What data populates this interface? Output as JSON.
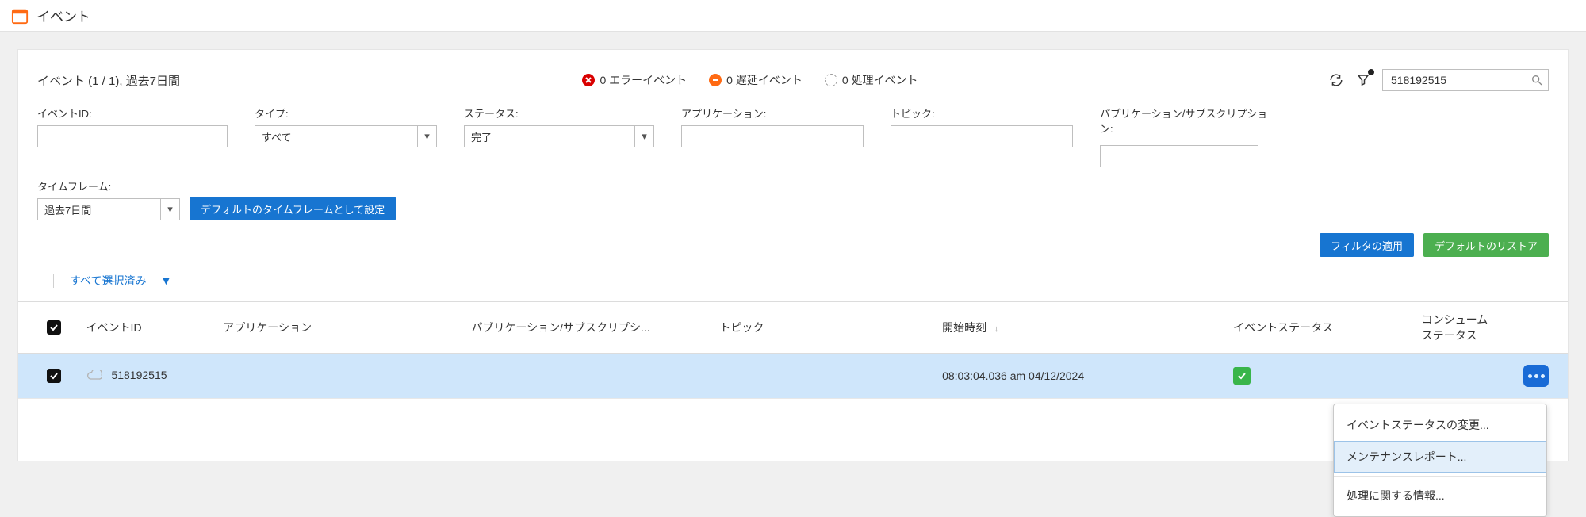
{
  "topbar": {
    "title": "イベント"
  },
  "summary": {
    "counter_label": "イベント (1 / 1), 過去7日間",
    "error_label": "0 エラーイベント",
    "delayed_label": "0 遅延イベント",
    "processing_label": "0 処理イベント",
    "search_value": "518192515"
  },
  "filters": {
    "event_id": {
      "label": "イベントID:"
    },
    "type": {
      "label": "タイプ:",
      "value": "すべて"
    },
    "status": {
      "label": "ステータス:",
      "value": "完了"
    },
    "application": {
      "label": "アプリケーション:"
    },
    "topic": {
      "label": "トピック:"
    },
    "pubsub": {
      "label": "パブリケーション/サブスクリプション:"
    },
    "timeframe": {
      "label": "タイムフレーム:",
      "value": "過去7日間"
    },
    "set_default_timeframe": "デフォルトのタイムフレームとして設定",
    "apply": "フィルタの適用",
    "restore": "デフォルトのリストア",
    "select_all": "すべて選択済み"
  },
  "columns": {
    "event_id": "イベントID",
    "application": "アプリケーション",
    "pubsub": "パブリケーション/サブスクリプシ...",
    "topic": "トピック",
    "start_time": "開始時刻",
    "event_status": "イベントステータス",
    "consume_status_line1": "コンシューム",
    "consume_status_line2": "ステータス"
  },
  "rows": [
    {
      "event_id": "518192515",
      "application": "",
      "pubsub": "",
      "topic": "",
      "start_time": "08:03:04.036 am 04/12/2024"
    }
  ],
  "menu": {
    "change_status": "イベントステータスの変更...",
    "maintenance_report": "メンテナンスレポート...",
    "processing_info": "処理に関する情報..."
  }
}
